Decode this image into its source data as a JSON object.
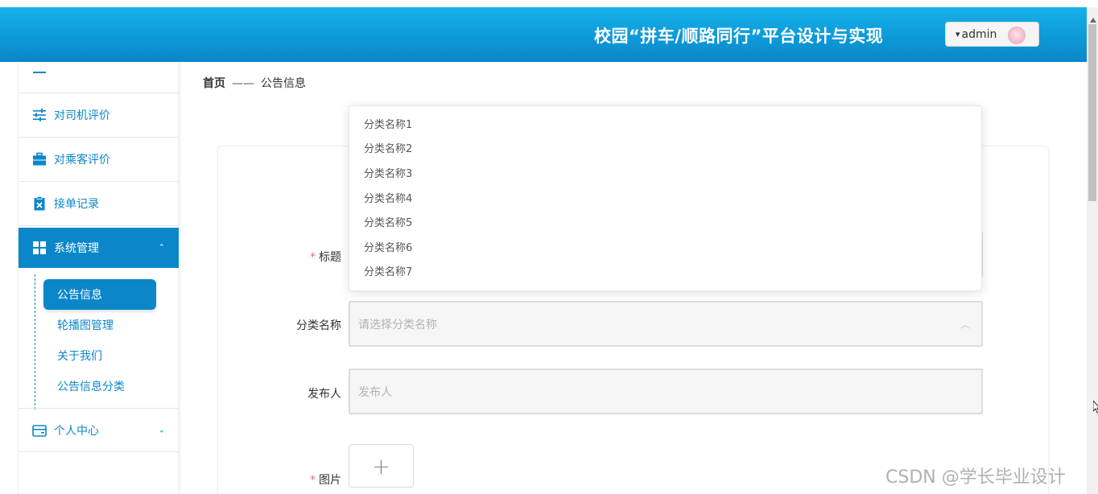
{
  "header": {
    "title": "校园“拼车/顺路同行”平台设计与实现",
    "user": {
      "caret": "▾",
      "name": "admin"
    }
  },
  "sidebar": {
    "items": [
      {
        "label": "对司机评价",
        "icon": "sliders-icon"
      },
      {
        "label": "对乘客评价",
        "icon": "briefcase-icon"
      },
      {
        "label": "接单记录",
        "icon": "clipboard-icon"
      },
      {
        "label": "系统管理",
        "icon": "grid-icon",
        "arrow": "⌃"
      },
      {
        "label": "个人中心",
        "icon": "card-icon",
        "arrow": "⌄"
      }
    ],
    "sub_items": [
      "公告信息",
      "轮播图管理",
      "关于我们",
      "公告信息分类"
    ]
  },
  "breadcrumb": {
    "home": "首页",
    "sep": "——",
    "current": "公告信息"
  },
  "form": {
    "title_label": "标题",
    "category_label": "分类名称",
    "category_placeholder": "请选择分类名称",
    "publisher_label": "发布人",
    "publisher_placeholder": "发布人",
    "image_label": "图片",
    "required_mark": "*",
    "upload_plus": "+"
  },
  "dropdown": {
    "options": [
      "分类名称1",
      "分类名称2",
      "分类名称3",
      "分类名称4",
      "分类名称5",
      "分类名称6",
      "分类名称7"
    ]
  },
  "watermark": "CSDN @学长毕业设计",
  "colors": {
    "primary": "#0b87c9",
    "header_top": "#16b1ea",
    "required": "#f56c6c"
  }
}
